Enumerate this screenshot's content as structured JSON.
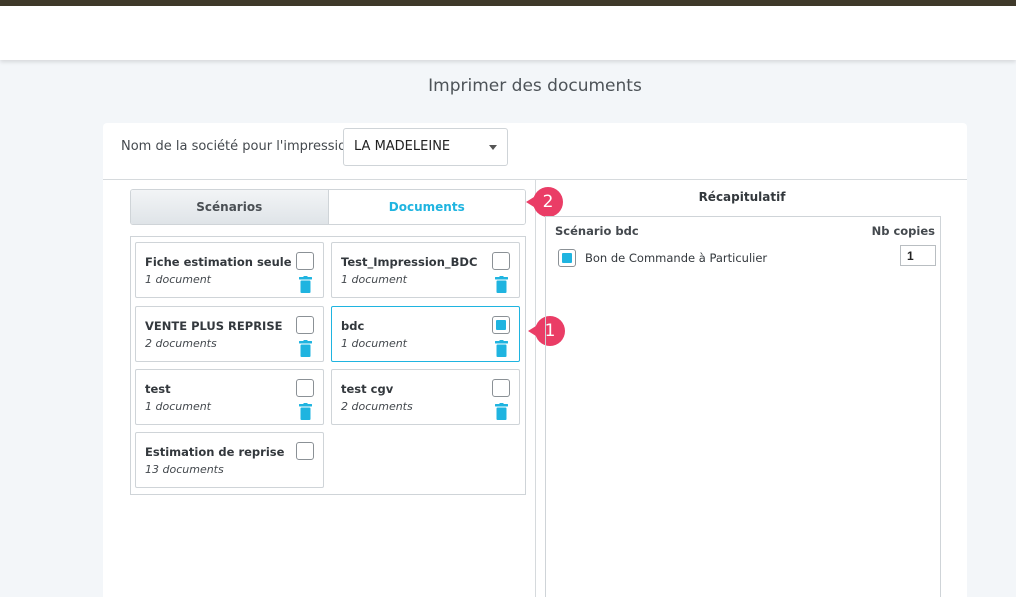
{
  "page_title": "Imprimer des documents",
  "company": {
    "label": "Nom de la société pour l'impression",
    "selected": "LA MADELEINE"
  },
  "tabs": [
    {
      "label": "Scénarios",
      "active": false
    },
    {
      "label": "Documents",
      "active": true
    }
  ],
  "scenarios": [
    {
      "name": "Fiche estimation seule",
      "count": "1 document",
      "checked": false,
      "deletable": true
    },
    {
      "name": "Test_Impression_BDC",
      "count": "1 document",
      "checked": false,
      "deletable": true
    },
    {
      "name": "VENTE PLUS REPRISE",
      "count": "2 documents",
      "checked": false,
      "deletable": true
    },
    {
      "name": "bdc",
      "count": "1 document",
      "checked": true,
      "deletable": true
    },
    {
      "name": "test",
      "count": "1 document",
      "checked": false,
      "deletable": true
    },
    {
      "name": "test cgv",
      "count": "2 documents",
      "checked": false,
      "deletable": true
    },
    {
      "name": "Estimation de reprise",
      "count": "13 documents",
      "checked": false,
      "deletable": false
    }
  ],
  "badges": {
    "one": "1",
    "two": "2"
  },
  "recap": {
    "title": "Récapitulatif",
    "scenario_label": "Scénario bdc",
    "copies_label": "Nb copies",
    "documents": [
      {
        "name": "Bon de Commande à Particulier",
        "copies": "1",
        "checked": true
      }
    ]
  },
  "colors": {
    "accent": "#1fb4e0",
    "badge": "#ea3d66",
    "topbar": "#3f3a2a"
  },
  "icons": {
    "delete": "trash-icon",
    "dropdown": "caret-down-icon"
  }
}
